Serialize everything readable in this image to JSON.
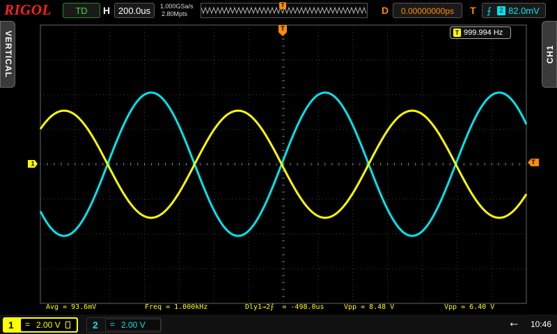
{
  "brand": "RIGOL",
  "topbar": {
    "run_state": "TD",
    "horizontal_label": "H",
    "timebase": "200.0us",
    "sample_rate": "1.000GSa/s",
    "memory_depth": "2.80Mpts",
    "trigger_marker": "T",
    "delay_label": "D",
    "delay_value": "0.00000000ps",
    "trigger_label": "T",
    "trigger_source": "2",
    "trigger_level": "82.0mV"
  },
  "side": {
    "left_tab": "VERTICAL",
    "right_tab": "CH1"
  },
  "frequency_counter": {
    "icon": "T",
    "value": "999.994 Hz"
  },
  "markers": {
    "ch1": "1",
    "trigger_level": "T",
    "trigger_pos": "T"
  },
  "measurements": {
    "avg": "Avg = 93.6mV",
    "freq": "Freq = 1.000kHz",
    "delay": "Dly1→2⨍  = -498.0us",
    "vpp1": "Vpp = 8.48 V",
    "vpp2": "Vpp = 6.40 V"
  },
  "channels": [
    {
      "number": "1",
      "coupling": "=",
      "scale": "2.00 V"
    },
    {
      "number": "2",
      "coupling": "=",
      "scale": "2.00 V"
    }
  ],
  "status": {
    "time": "10:46",
    "usb_icon": "usb-icon"
  },
  "colors": {
    "ch1": "#ffff00",
    "ch2": "#00e5ee",
    "accent": "#ff8c00",
    "brand": "#ff2020"
  }
}
